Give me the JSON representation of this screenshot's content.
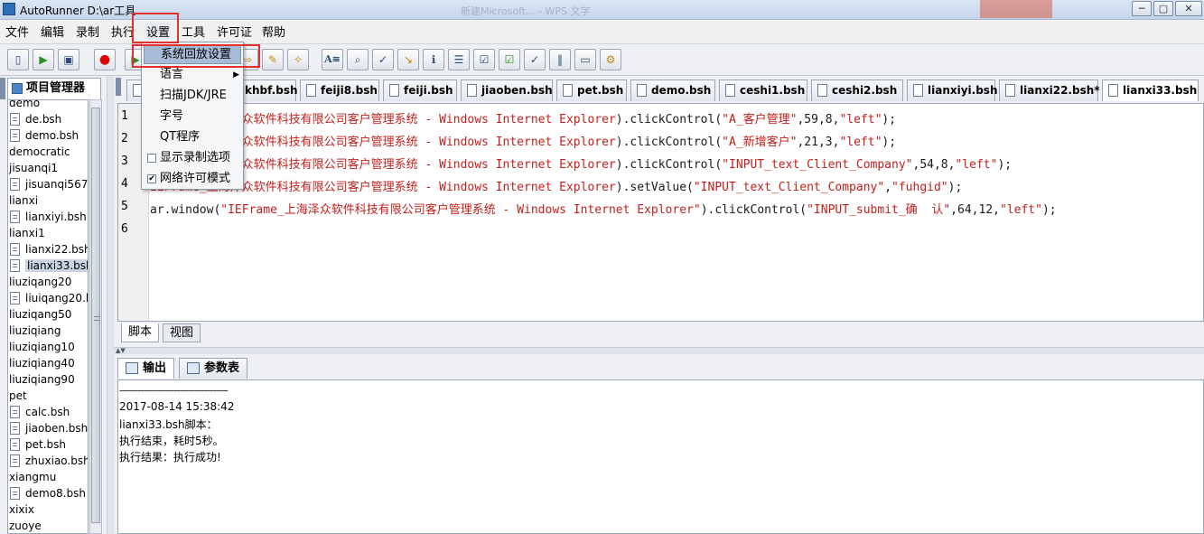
{
  "window": {
    "title": "AutoRunner  D:\\ar工具",
    "ghost_title": "新建Microsoft...  - WPS 文字",
    "controls": [
      "─",
      "▢",
      "✕"
    ]
  },
  "menubar": {
    "items": [
      "文件",
      "编辑",
      "录制",
      "执行",
      "设置",
      "工具",
      "许可证",
      "帮助"
    ],
    "active": "设置"
  },
  "settings_menu": {
    "items": [
      {
        "label": "系统回放设置",
        "highlighted": true
      },
      {
        "label": "语言",
        "submenu": true,
        "arrow": "▶"
      },
      {
        "label": "扫描JDK/JRE"
      },
      {
        "label": "字号"
      },
      {
        "label": "QT程序"
      },
      {
        "label": "显示录制选项",
        "checked": false,
        "check_glyph": ""
      },
      {
        "label": "网络许可模式",
        "checked": true,
        "check_glyph": "✔"
      }
    ]
  },
  "toolbar": {
    "buttons": [
      {
        "icon": "new-file-icon",
        "glyph": "▯"
      },
      {
        "icon": "open-file-icon",
        "glyph": "▶"
      },
      {
        "icon": "save-icon",
        "glyph": "▣"
      },
      {
        "icon": "record-icon",
        "glyph": "●"
      },
      {
        "icon": "play-icon",
        "glyph": "▶"
      },
      {
        "icon": "step-icon",
        "glyph": "⇨"
      },
      {
        "icon": "pen-icon",
        "glyph": "✎"
      },
      {
        "icon": "magic-wand-icon",
        "glyph": "✧"
      },
      {
        "icon": "text-icon",
        "glyph": "A≡"
      },
      {
        "icon": "find-icon",
        "glyph": "⌕"
      },
      {
        "icon": "check-icon",
        "glyph": "✓"
      },
      {
        "icon": "arrow-in-icon",
        "glyph": "↘"
      },
      {
        "icon": "info-icon",
        "glyph": "ℹ"
      },
      {
        "icon": "list-icon",
        "glyph": "☰"
      },
      {
        "icon": "check-list-icon",
        "glyph": "☑"
      },
      {
        "icon": "check-box-icon",
        "glyph": "☑"
      },
      {
        "icon": "check-arrow-icon",
        "glyph": "✓"
      },
      {
        "icon": "columns-icon",
        "glyph": "‖"
      },
      {
        "icon": "comment-icon",
        "glyph": "▭"
      },
      {
        "icon": "settings-icon",
        "glyph": "⚙"
      }
    ]
  },
  "project_manager": {
    "tab_label": "项目管理器",
    "tree": [
      {
        "type": "folder",
        "label": "demo"
      },
      {
        "type": "file",
        "label": "de.bsh"
      },
      {
        "type": "file",
        "label": "demo.bsh"
      },
      {
        "type": "folder",
        "label": "democratic"
      },
      {
        "type": "folder",
        "label": "jisuanqi1"
      },
      {
        "type": "file",
        "label": "jisuanqi567."
      },
      {
        "type": "folder",
        "label": "lianxi"
      },
      {
        "type": "file",
        "label": "lianxiyi.bsh"
      },
      {
        "type": "folder",
        "label": "lianxi1"
      },
      {
        "type": "file",
        "label": "lianxi22.bsh"
      },
      {
        "type": "file",
        "label": "lianxi33.bsh",
        "selected": true
      },
      {
        "type": "folder",
        "label": "liuziqang20"
      },
      {
        "type": "file",
        "label": "liuiqang20.b"
      },
      {
        "type": "folder",
        "label": "liuziqang50"
      },
      {
        "type": "folder",
        "label": "liuziqiang"
      },
      {
        "type": "folder",
        "label": "liuziqiang10"
      },
      {
        "type": "folder",
        "label": "liuziqiang40"
      },
      {
        "type": "folder",
        "label": "liuziqiang90"
      },
      {
        "type": "folder",
        "label": "pet"
      },
      {
        "type": "file",
        "label": "calc.bsh"
      },
      {
        "type": "file",
        "label": "jiaoben.bsh"
      },
      {
        "type": "file",
        "label": "pet.bsh"
      },
      {
        "type": "file",
        "label": "zhuxiao.bsh"
      },
      {
        "type": "folder",
        "label": "xiangmu"
      },
      {
        "type": "file",
        "label": "demo8.bsh"
      },
      {
        "type": "folder",
        "label": "xixix"
      },
      {
        "type": "folder",
        "label": "zuoye"
      }
    ]
  },
  "editor_tabs": [
    {
      "label": "khbf.bsh"
    },
    {
      "label": "feiji8.bsh"
    },
    {
      "label": "feiji.bsh"
    },
    {
      "label": "jiaoben.bsh"
    },
    {
      "label": "pet.bsh"
    },
    {
      "label": "demo.bsh"
    },
    {
      "label": "ceshi1.bsh"
    },
    {
      "label": "ceshi2.bsh"
    },
    {
      "label": "lianxiyi.bsh"
    },
    {
      "label": "lianxi22.bsh*"
    },
    {
      "label": "lianxi33.bsh",
      "active": true
    }
  ],
  "code": {
    "lines": [
      {
        "num": "1",
        "parts": [
          {
            "t": "IEFrame_上海泽众软件科技有限公司客户管理系统 - Windows Internet Explorer",
            "c": "str"
          },
          {
            "t": ").clickControl(",
            "c": "plain"
          },
          {
            "t": "\"A_客户管理\"",
            "c": "str"
          },
          {
            "t": ",59,8,",
            "c": "plain"
          },
          {
            "t": "\"left\"",
            "c": "str"
          },
          {
            "t": ");",
            "c": "plain"
          }
        ]
      },
      {
        "num": "2",
        "parts": [
          {
            "t": "IEFrame_上海泽众软件科技有限公司客户管理系统 - Windows Internet Explorer",
            "c": "str"
          },
          {
            "t": ").clickControl(",
            "c": "plain"
          },
          {
            "t": "\"A_新增客户\"",
            "c": "str"
          },
          {
            "t": ",21,3,",
            "c": "plain"
          },
          {
            "t": "\"left\"",
            "c": "str"
          },
          {
            "t": ");",
            "c": "plain"
          }
        ]
      },
      {
        "num": "3",
        "parts": [
          {
            "t": "IEFrame_上海泽众软件科技有限公司客户管理系统 - Windows Internet Explorer",
            "c": "str"
          },
          {
            "t": ").clickControl(",
            "c": "plain"
          },
          {
            "t": "\"INPUT_text_Client_Company\"",
            "c": "str"
          },
          {
            "t": ",54,8,",
            "c": "plain"
          },
          {
            "t": "\"left\"",
            "c": "str"
          },
          {
            "t": ");",
            "c": "plain"
          }
        ]
      },
      {
        "num": "4",
        "parts": [
          {
            "t": "IEFrame_上海泽众软件科技有限公司客户管理系统 - Windows Internet Explorer",
            "c": "str"
          },
          {
            "t": ").setValue(",
            "c": "plain"
          },
          {
            "t": "\"INPUT_text_Client_Company\"",
            "c": "str"
          },
          {
            "t": ",",
            "c": "plain"
          },
          {
            "t": "\"fuhgid\"",
            "c": "str"
          },
          {
            "t": ");",
            "c": "plain"
          }
        ]
      },
      {
        "num": "5",
        "parts": [
          {
            "t": "ar.window(",
            "c": "plain"
          },
          {
            "t": "\"IEFrame_上海泽众软件科技有限公司客户管理系统 - Windows Internet Explorer\"",
            "c": "str"
          },
          {
            "t": ").clickControl(",
            "c": "plain"
          },
          {
            "t": "\"INPUT_submit_确  认\"",
            "c": "str"
          },
          {
            "t": ",64,12,",
            "c": "plain"
          },
          {
            "t": "\"left\"",
            "c": "str"
          },
          {
            "t": ");",
            "c": "plain"
          }
        ]
      },
      {
        "num": "6",
        "parts": []
      }
    ]
  },
  "editor_subtabs": [
    {
      "label": "脚本",
      "active": true
    },
    {
      "label": "视图"
    }
  ],
  "output_tabs": [
    {
      "label": "输出",
      "active": true,
      "icon": "console-icon"
    },
    {
      "label": "参数表",
      "icon": "table-icon"
    }
  ],
  "output": {
    "lines": [
      "------------------------------------",
      "2017-08-14 15:38:42",
      "lianxi33.bsh脚本：",
      "执行结束，耗时5秒。",
      "执行结果：执行成功!"
    ]
  },
  "colors": {
    "string": "#c3201c",
    "highlight_frame": "#e03030",
    "menu_highlight": "#a7bad6"
  }
}
